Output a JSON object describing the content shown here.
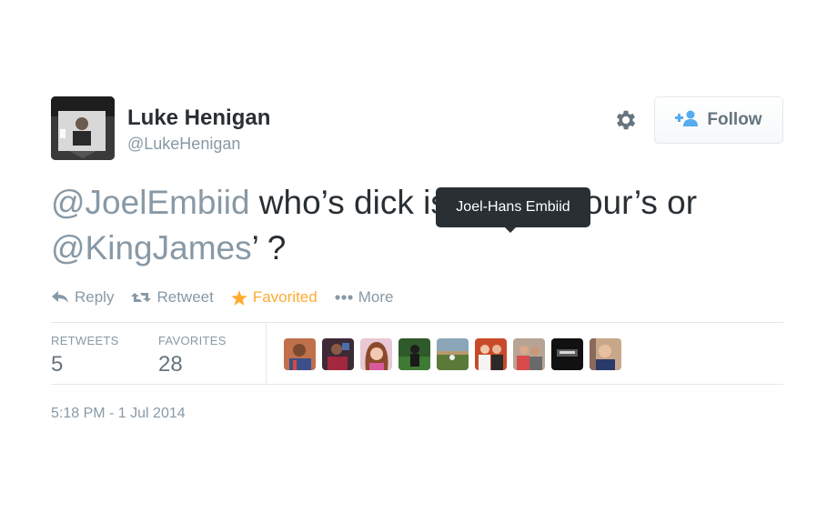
{
  "tweet": {
    "author_name": "Luke Henigan",
    "author_handle": "@LukeHenigan",
    "follow_label": "Follow",
    "text": {
      "mention1": "@JoelEmbiid",
      "body1": " who’s dick is bigger, your’s or ",
      "mention2": "@KingJames",
      "body2": "’ ?"
    },
    "actions": {
      "reply": "Reply",
      "retweet": "Retweet",
      "favorited": "Favorited",
      "more": "More"
    },
    "tooltip": "Joel-Hans Embiid",
    "stats": {
      "retweets_label": "RETWEETS",
      "retweets_value": "5",
      "favorites_label": "FAVORITES",
      "favorites_value": "28"
    },
    "timestamp": "5:18 PM - 1 Jul 2014"
  },
  "colors": {
    "text": "#292f33",
    "muted": "#8899a6",
    "favorite": "#ffac33",
    "follow_icon": "#55acee",
    "tooltip_bg": "#292f33"
  },
  "icons": {
    "settings": "gear-icon",
    "follow": "add-user-icon",
    "reply": "reply-icon",
    "retweet": "retweet-icon",
    "favorite": "star-icon",
    "more": "more-dots-icon"
  }
}
